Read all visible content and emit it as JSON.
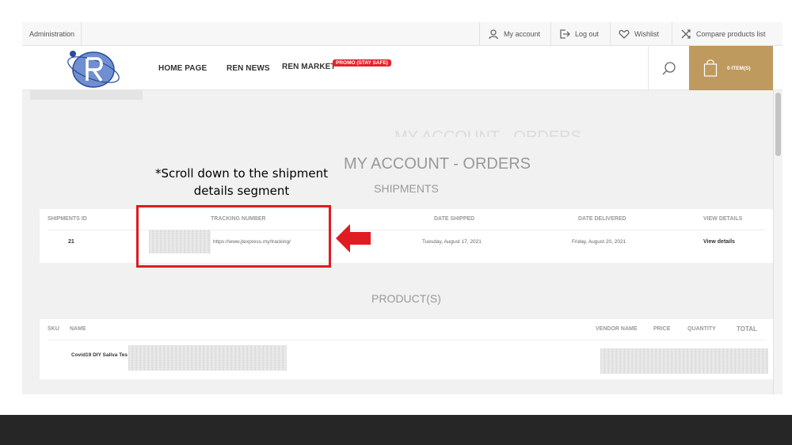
{
  "topbar": {
    "admin": "Administration",
    "my_account": "My account",
    "log_out": "Log out",
    "wishlist": "Wishlist",
    "compare": "Compare products list"
  },
  "header": {
    "nav": [
      "HOME PAGE",
      "REN NEWS",
      "REN MARKET"
    ],
    "promo": "PROMO (STAY SAFE)",
    "cart": "0 ITEM(S)",
    "accent_color": "#bf9a5e",
    "promo_color": "#e8222b"
  },
  "page": {
    "ghost_title": "MY ACCOUNT - ORDERS",
    "title": "MY ACCOUNT - ORDERS",
    "shipments_heading": "SHIPMENTS",
    "products_heading": "PRODUCT(S)"
  },
  "shipments": {
    "headers": [
      "SHIPMENTS ID",
      "TRACKING NUMBER",
      "DATE SHIPPED",
      "DATE DELIVERED",
      "VIEW DETAILS"
    ],
    "row": {
      "id": "21",
      "tracking_url": "https://www.jtexpress.my/tracking/",
      "date_shipped": "Tuesday, August 17, 2021",
      "date_delivered": "Friday, August 20, 2021",
      "view_details": "View details"
    }
  },
  "products": {
    "headers": [
      "SKU",
      "NAME",
      "VENDOR NAME",
      "PRICE",
      "QUANTITY",
      "TOTAL"
    ],
    "row": {
      "name": "Covid19 DIY Saliva Tes"
    }
  },
  "annotation": {
    "line1": "*Scroll down to the shipment",
    "line2": "details segment",
    "color": "#e01b22"
  }
}
